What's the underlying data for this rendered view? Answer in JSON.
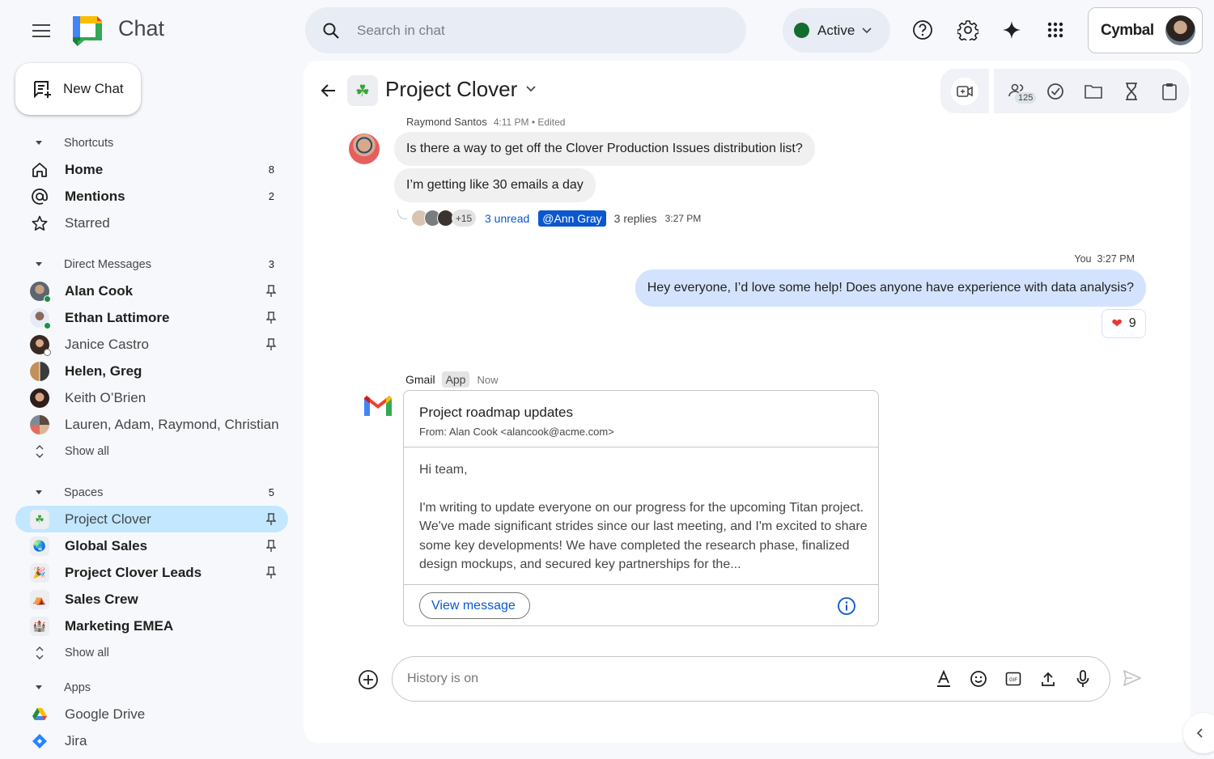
{
  "app": {
    "title": "Chat"
  },
  "header": {
    "search_placeholder": "Search in chat",
    "status": {
      "label": "Active",
      "color": "#146c2e"
    },
    "icons": [
      "help-icon",
      "settings-icon",
      "gemini-sparkle-icon",
      "apps-grid-icon"
    ],
    "account": {
      "brand": "Cymbal"
    }
  },
  "sidebar": {
    "new_chat_label": "New Chat",
    "shortcuts": {
      "label": "Shortcuts",
      "items": [
        {
          "label": "Home",
          "count": "8",
          "icon": "home-icon",
          "bold": true
        },
        {
          "label": "Mentions",
          "count": "2",
          "icon": "at-icon",
          "bold": true
        },
        {
          "label": "Starred",
          "count": "",
          "icon": "star-icon",
          "bold": false
        }
      ]
    },
    "direct_messages": {
      "label": "Direct Messages",
      "count": "3",
      "items": [
        {
          "label": "Alan Cook",
          "bold": true,
          "pinned": true,
          "presence": "online"
        },
        {
          "label": "Ethan Lattimore",
          "bold": true,
          "pinned": true,
          "presence": "online"
        },
        {
          "label": "Janice Castro",
          "bold": false,
          "pinned": true,
          "presence": "away"
        },
        {
          "label": "Helen, Greg",
          "bold": true,
          "pinned": false,
          "presence": ""
        },
        {
          "label": "Keith O’Brien",
          "bold": false,
          "pinned": false,
          "presence": ""
        },
        {
          "label": "Lauren, Adam, Raymond, Christian",
          "bold": false,
          "pinned": false,
          "presence": ""
        }
      ],
      "show_all": "Show all"
    },
    "spaces": {
      "label": "Spaces",
      "count": "5",
      "items": [
        {
          "label": "Project Clover",
          "emoji": "☘",
          "bold": false,
          "pinned": true,
          "selected": true
        },
        {
          "label": "Global Sales",
          "emoji": "🌏",
          "bold": true,
          "pinned": true,
          "selected": false
        },
        {
          "label": "Project Clover Leads",
          "emoji": "🎉",
          "bold": true,
          "pinned": true,
          "selected": false
        },
        {
          "label": "Sales Crew",
          "emoji": "⛺",
          "bold": true,
          "pinned": false,
          "selected": false
        },
        {
          "label": "Marketing EMEA",
          "emoji": "🏰",
          "bold": true,
          "pinned": false,
          "selected": false
        }
      ],
      "show_all": "Show all"
    },
    "apps": {
      "label": "Apps",
      "items": [
        {
          "label": "Google Drive",
          "icon": "google-drive-icon"
        },
        {
          "label": "Jira",
          "icon": "jira-icon"
        }
      ]
    }
  },
  "conversation": {
    "space_name": "Project Clover",
    "space_emoji": "☘",
    "member_count": "125",
    "toolbar_icons": [
      "video-call-icon",
      "members-icon",
      "tasks-icon",
      "files-icon",
      "hourglass-icon",
      "clipboard-icon"
    ],
    "messages": [
      {
        "sender": "Raymond Santos",
        "time": "4:11 PM • Edited",
        "lines": [
          "Is there a way to get off the Clover Production Issues distribution list?",
          "I’m getting like 30 emails a day"
        ],
        "thread": {
          "extra_participants": "+15",
          "unread": "3 unread",
          "mention": "@Ann Gray",
          "replies": "3 replies",
          "last_reply_time": "3:27 PM"
        }
      },
      {
        "sender": "You",
        "time": "3:27 PM",
        "text": "Hey everyone, I’d love some help!  Does anyone have experience with data analysis?",
        "reaction": {
          "emoji": "❤️",
          "count": "9"
        }
      }
    ],
    "app_message": {
      "app_name": "Gmail",
      "tag": "App",
      "time": "Now",
      "card": {
        "subject": "Project roadmap updates",
        "from": "From: Alan Cook <alancook@acme.com>",
        "greeting": "Hi team,",
        "body": "I'm writing to update everyone on our progress for the upcoming Titan project. We've made significant strides since our last meeting, and I'm excited to share some key developments! We have completed the research phase, finalized design mockups, and secured key partnerships for the...",
        "button": "View message"
      }
    },
    "composer": {
      "placeholder": "History is on",
      "icons": [
        "format-text-icon",
        "emoji-icon",
        "gif-icon",
        "upload-icon",
        "mic-icon"
      ]
    }
  }
}
